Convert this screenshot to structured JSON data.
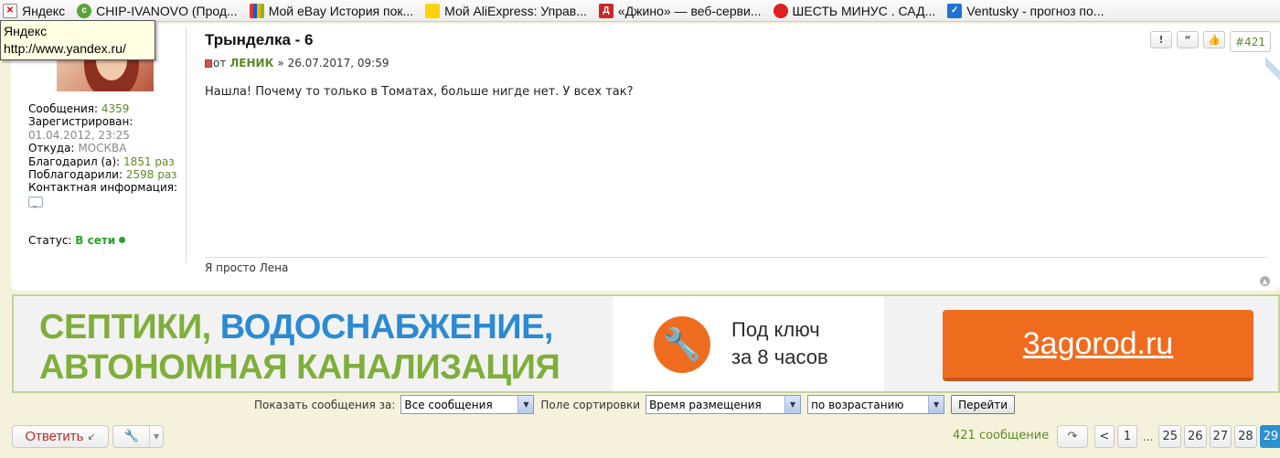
{
  "bookmarks": [
    {
      "label": "Яндекс",
      "icon": "broken-image-icon"
    },
    {
      "label": "CHIP-IVANOVO (Прод...",
      "icon": "chip-icon"
    },
    {
      "label": "Мой eBay История пок...",
      "icon": "ebay-icon"
    },
    {
      "label": "Мой AliExpress: Управ...",
      "icon": "aliexpress-icon"
    },
    {
      "label": "«Джино» — веб-серви...",
      "icon": "djino-icon"
    },
    {
      "label": "ШЕСТЬ МИНУС . САД...",
      "icon": "tomato-icon"
    },
    {
      "label": "Ventusky - прогноз по...",
      "icon": "ventusky-icon"
    }
  ],
  "tooltip": {
    "title": "Яндекс",
    "url": "http://www.yandex.ru/"
  },
  "profile": {
    "posts_label": "Сообщения:",
    "posts_value": "4359",
    "registered_label": "Зарегистрирован:",
    "registered_value": "01.04.2012, 23:25",
    "from_label": "Откуда:",
    "from_value": "МОСКВА",
    "thanked_label": "Благодарил (а):",
    "thanked_value": "1851 раз",
    "thanks_label": "Поблагодарили:",
    "thanks_value": "2598 раз",
    "contact_label": "Контактная информация:",
    "status_label": "Статус:",
    "status_value": "В сети"
  },
  "post": {
    "title": "Трынделка - 6",
    "meta_prefix": "от",
    "author": "ЛЕНИК",
    "date": "» 26.07.2017, 09:59",
    "body": "Нашла! Почему то только в Томатах, больше нигде нет. У всех так?",
    "signature": "Я просто Лена",
    "number": "#421",
    "tools": {
      "report": "!",
      "quote": "“",
      "like": "👍"
    }
  },
  "banner": {
    "line1_green": "СЕПТИКИ,",
    "line1_blue": "ВОДОСНАБЖЕНИЕ,",
    "line2": "АВТОНОМНАЯ КАНАЛИЗАЦИЯ",
    "mid_line1": "Под ключ",
    "mid_line2": "за 8 часов",
    "cta": "3agorod.ru"
  },
  "filters": {
    "show_label": "Показать сообщения за:",
    "show_value": "Все сообщения",
    "sort_label": "Поле сортировки",
    "sort_value": "Время размещения",
    "order_value": "по возрастанию",
    "go_label": "Перейти"
  },
  "actions": {
    "reply_label": "Ответить",
    "message_count": "421 сообщение"
  },
  "pagination": {
    "prev": "<",
    "first": "1",
    "ellipsis": "...",
    "pages": [
      "25",
      "26",
      "27",
      "28",
      "29"
    ],
    "current": "29"
  }
}
